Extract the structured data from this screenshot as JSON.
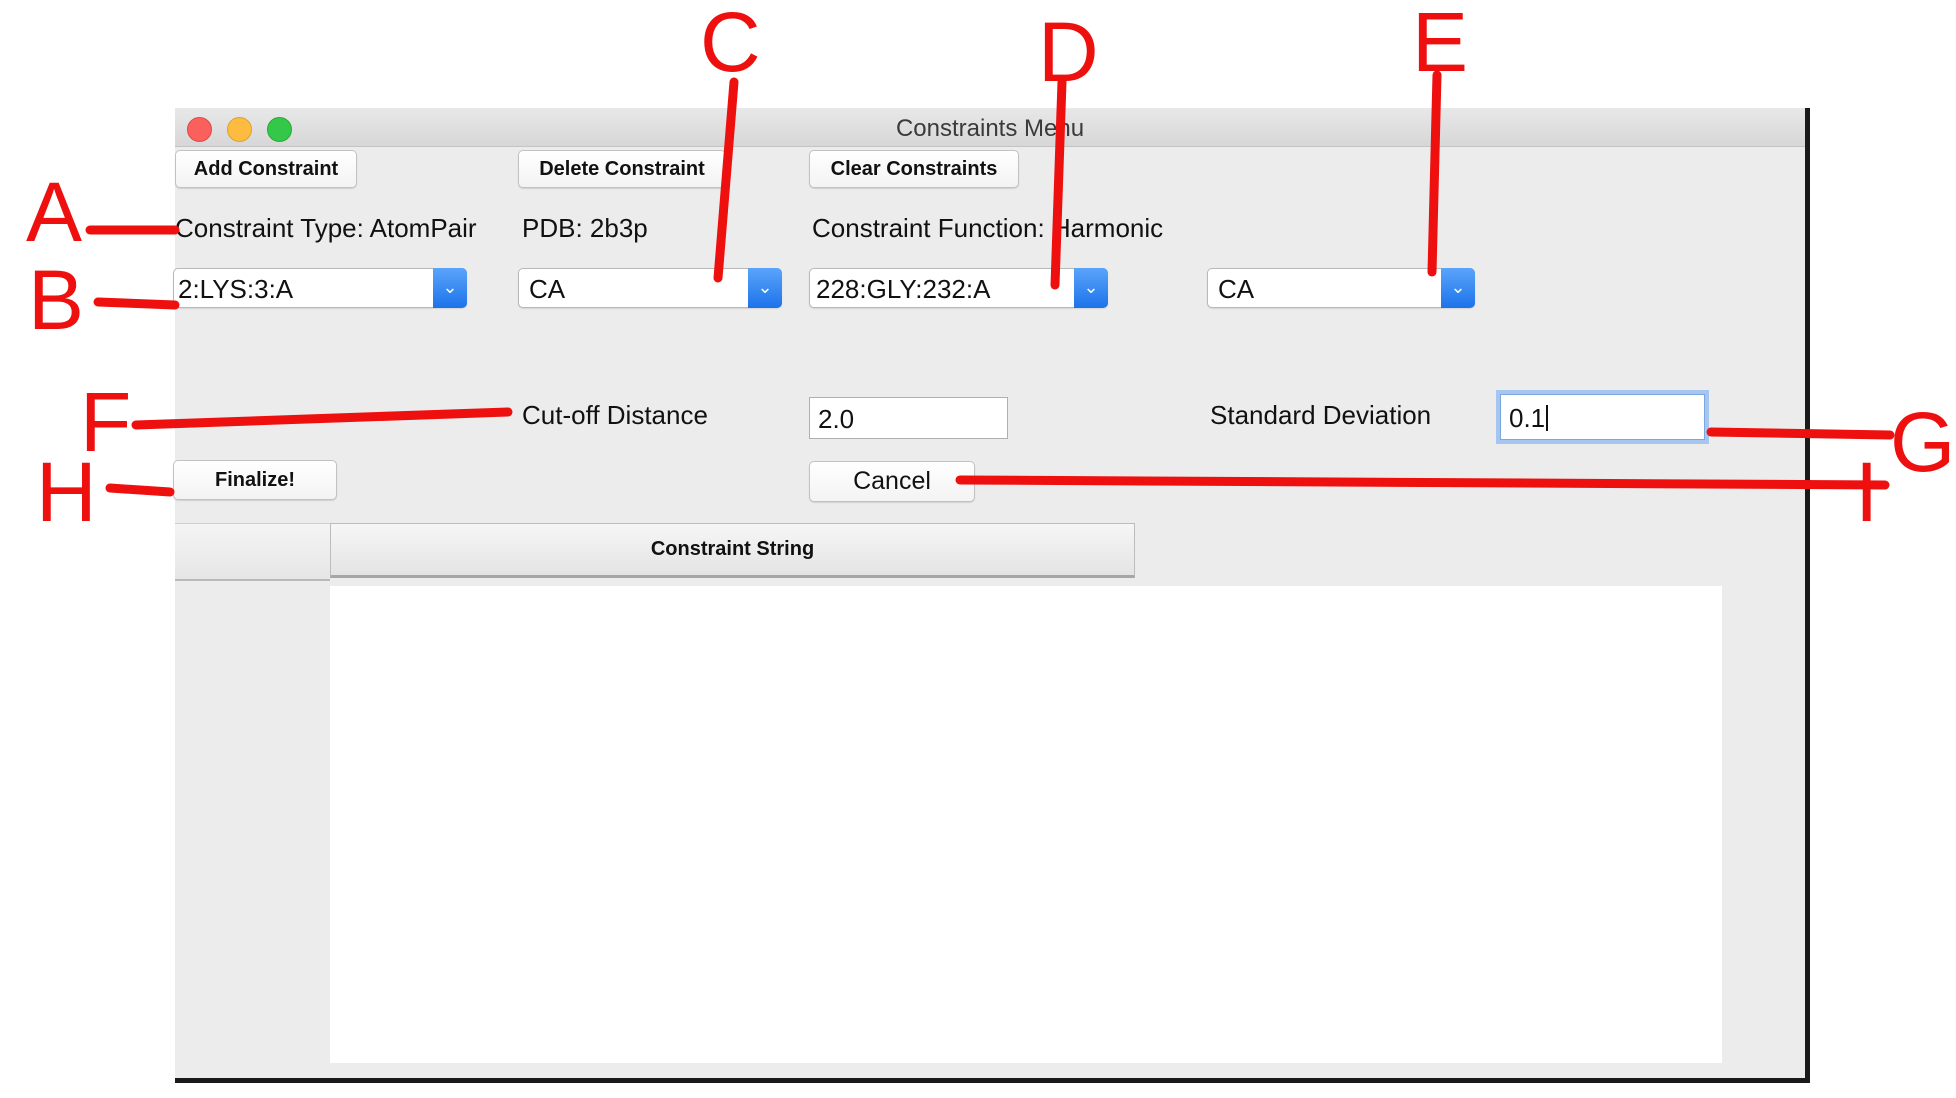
{
  "window": {
    "title": "Constraints Menu"
  },
  "toolbar": {
    "add_label": "Add Constraint",
    "delete_label": "Delete Constraint",
    "clear_label": "Clear Constraints"
  },
  "info": {
    "constraint_type": "Constraint Type: AtomPair",
    "pdb": "PDB: 2b3p",
    "constraint_function": "Constraint Function: Harmonic"
  },
  "selectors": {
    "residue_1": "2:LYS:3:A",
    "atom_1": "CA",
    "residue_2": "228:GLY:232:A",
    "atom_2": "CA"
  },
  "params": {
    "cutoff_label": "Cut-off Distance",
    "cutoff_value": "2.0",
    "stddev_label": "Standard Deviation",
    "stddev_value": "0.1"
  },
  "actions": {
    "finalize_label": "Finalize!",
    "cancel_label": "Cancel"
  },
  "table": {
    "columns": [
      "",
      "Constraint String"
    ]
  },
  "annotations": {
    "labels": [
      "A",
      "B",
      "C",
      "D",
      "E",
      "F",
      "G",
      "H",
      "I"
    ],
    "color": "#ee0f0f"
  },
  "colors": {
    "combo_arrow": "#1c73ea",
    "focus_ring": "#a4c6f1"
  }
}
